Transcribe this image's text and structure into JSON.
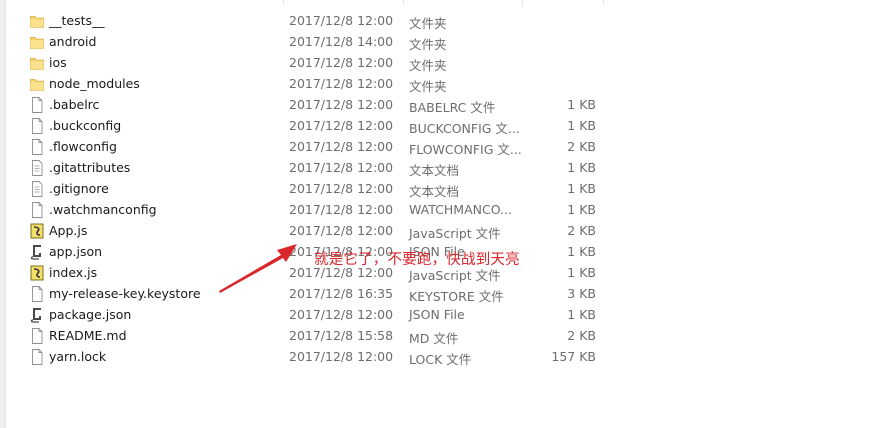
{
  "files": [
    {
      "name": "__tests__",
      "date": "2017/12/8 12:00",
      "type": "文件夹",
      "size": "",
      "icon": "folder-icon"
    },
    {
      "name": "android",
      "date": "2017/12/8 14:00",
      "type": "文件夹",
      "size": "",
      "icon": "folder-icon"
    },
    {
      "name": "ios",
      "date": "2017/12/8 12:00",
      "type": "文件夹",
      "size": "",
      "icon": "folder-icon"
    },
    {
      "name": "node_modules",
      "date": "2017/12/8 12:00",
      "type": "文件夹",
      "size": "",
      "icon": "folder-icon"
    },
    {
      "name": ".babelrc",
      "date": "2017/12/8 12:00",
      "type": "BABELRC 文件",
      "size": "1 KB",
      "icon": "file-icon"
    },
    {
      "name": ".buckconfig",
      "date": "2017/12/8 12:00",
      "type": "BUCKCONFIG 文...",
      "size": "1 KB",
      "icon": "file-icon"
    },
    {
      "name": ".flowconfig",
      "date": "2017/12/8 12:00",
      "type": "FLOWCONFIG 文...",
      "size": "2 KB",
      "icon": "file-icon"
    },
    {
      "name": ".gitattributes",
      "date": "2017/12/8 12:00",
      "type": "文本文档",
      "size": "1 KB",
      "icon": "text-file-icon"
    },
    {
      "name": ".gitignore",
      "date": "2017/12/8 12:00",
      "type": "文本文档",
      "size": "1 KB",
      "icon": "text-file-icon"
    },
    {
      "name": ".watchmanconfig",
      "date": "2017/12/8 12:00",
      "type": "WATCHMANCO...",
      "size": "1 KB",
      "icon": "file-icon"
    },
    {
      "name": "App.js",
      "date": "2017/12/8 12:00",
      "type": "JavaScript 文件",
      "size": "2 KB",
      "icon": "js-file-icon"
    },
    {
      "name": "app.json",
      "date": "2017/12/8 12:00",
      "type": "JSON File",
      "size": "1 KB",
      "icon": "json-file-icon"
    },
    {
      "name": "index.js",
      "date": "2017/12/8 12:00",
      "type": "JavaScript 文件",
      "size": "1 KB",
      "icon": "js-file-icon"
    },
    {
      "name": "my-release-key.keystore",
      "date": "2017/12/8 16:35",
      "type": "KEYSTORE 文件",
      "size": "3 KB",
      "icon": "file-icon"
    },
    {
      "name": "package.json",
      "date": "2017/12/8 12:00",
      "type": "JSON File",
      "size": "1 KB",
      "icon": "json-file-icon"
    },
    {
      "name": "README.md",
      "date": "2017/12/8 15:58",
      "type": "MD 文件",
      "size": "2 KB",
      "icon": "file-icon"
    },
    {
      "name": "yarn.lock",
      "date": "2017/12/8 12:00",
      "type": "LOCK 文件",
      "size": "157 KB",
      "icon": "file-icon"
    }
  ],
  "annotation": {
    "text": "就是它了，不要跑，快战到天亮",
    "color": "#d9262b"
  }
}
